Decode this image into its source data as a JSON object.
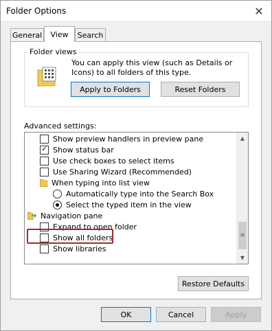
{
  "window": {
    "title": "Folder Options",
    "close_icon": "close-icon"
  },
  "tabs": [
    {
      "label": "General",
      "active": false
    },
    {
      "label": "View",
      "active": true
    },
    {
      "label": "Search",
      "active": false
    }
  ],
  "folder_views": {
    "label": "Folder views",
    "description": "You can apply this view (such as Details or Icons) to all folders of this type.",
    "apply_button": "Apply to Folders",
    "reset_button": "Reset Folders"
  },
  "advanced": {
    "label": "Advanced settings:",
    "items": [
      {
        "type": "checkbox",
        "label": "Show preview handlers in preview pane",
        "checked": false
      },
      {
        "type": "checkbox",
        "label": "Show status bar",
        "checked": true
      },
      {
        "type": "checkbox",
        "label": "Use check boxes to select items",
        "checked": false
      },
      {
        "type": "checkbox",
        "label": "Use Sharing Wizard (Recommended)",
        "checked": false
      },
      {
        "type": "folder",
        "label": "When typing into list view"
      },
      {
        "type": "radio",
        "label": "Automatically type into the Search Box",
        "checked": false
      },
      {
        "type": "radio",
        "label": "Select the typed item in the view",
        "checked": true
      },
      {
        "type": "folder",
        "label": "Navigation pane"
      },
      {
        "type": "checkbox",
        "label": "Expand to open folder",
        "checked": false
      },
      {
        "type": "checkbox",
        "label": "Show all folders",
        "checked": false
      },
      {
        "type": "checkbox",
        "label": "Show libraries",
        "checked": false
      }
    ],
    "check_mark": "✓",
    "scroll_up": "▲",
    "scroll_down": "▼",
    "scroll_grip": "≡"
  },
  "restore_button": "Restore Defaults",
  "dialog_buttons": {
    "ok": "OK",
    "cancel": "Cancel",
    "apply": "Apply"
  },
  "colors": {
    "highlight": "#b1252a",
    "folder": "#f0c94d",
    "focus": "#0078d7"
  }
}
